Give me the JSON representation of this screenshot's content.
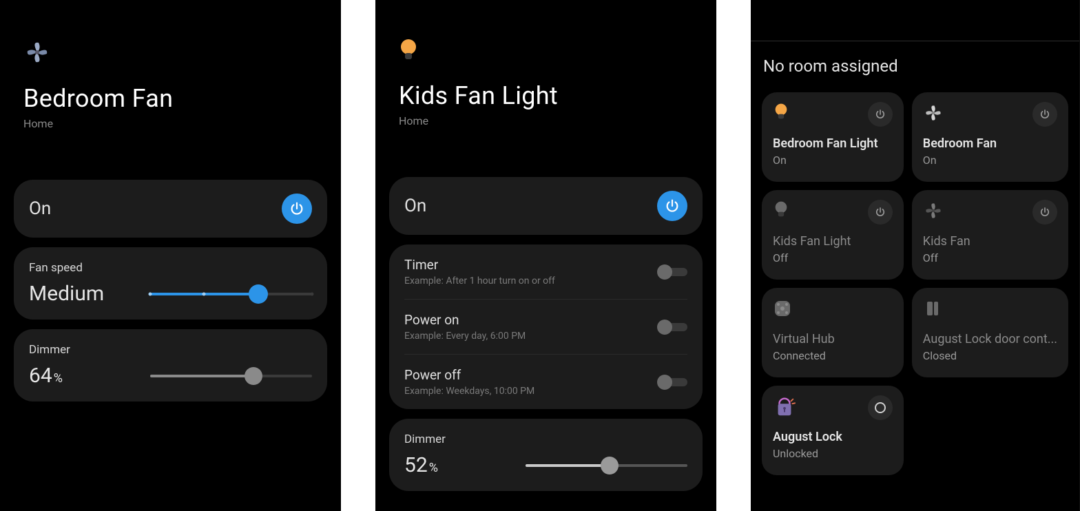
{
  "panel1": {
    "title": "Bedroom Fan",
    "sub": "Home",
    "on_label": "On",
    "fan_speed": {
      "label": "Fan speed",
      "value_label": "Medium",
      "step_index": 2,
      "steps": 4
    },
    "dimmer": {
      "label": "Dimmer",
      "value": 64,
      "unit": "%"
    }
  },
  "panel2": {
    "title": "Kids Fan Light",
    "sub": "Home",
    "on_label": "On",
    "schedules": [
      {
        "title": "Timer",
        "sub": "Example: After 1 hour turn on or off",
        "enabled": false
      },
      {
        "title": "Power on",
        "sub": "Example: Every day, 6:00 PM",
        "enabled": false
      },
      {
        "title": "Power off",
        "sub": "Example: Weekdays, 10:00 PM",
        "enabled": false
      }
    ],
    "dimmer": {
      "label": "Dimmer",
      "value": 52,
      "unit": "%"
    }
  },
  "panel3": {
    "heading": "No room assigned",
    "tiles": [
      {
        "name": "Bedroom Fan Light",
        "status": "On",
        "icon": "bulb",
        "on": true,
        "has_power": true
      },
      {
        "name": "Bedroom Fan",
        "status": "On",
        "icon": "fan",
        "on": true,
        "has_power": true
      },
      {
        "name": "Kids Fan Light",
        "status": "Off",
        "icon": "bulb",
        "on": false,
        "has_power": true
      },
      {
        "name": "Kids Fan",
        "status": "Off",
        "icon": "fan",
        "on": false,
        "has_power": true
      },
      {
        "name": "Virtual Hub",
        "status": "Connected",
        "icon": "hub",
        "on": false,
        "has_power": false
      },
      {
        "name": "August Lock door cont...",
        "status": "Closed",
        "icon": "sensor",
        "on": false,
        "has_power": false
      },
      {
        "name": "August Lock",
        "status": "Unlocked",
        "icon": "lock",
        "on": true,
        "has_power": false,
        "has_circle": true
      }
    ]
  }
}
